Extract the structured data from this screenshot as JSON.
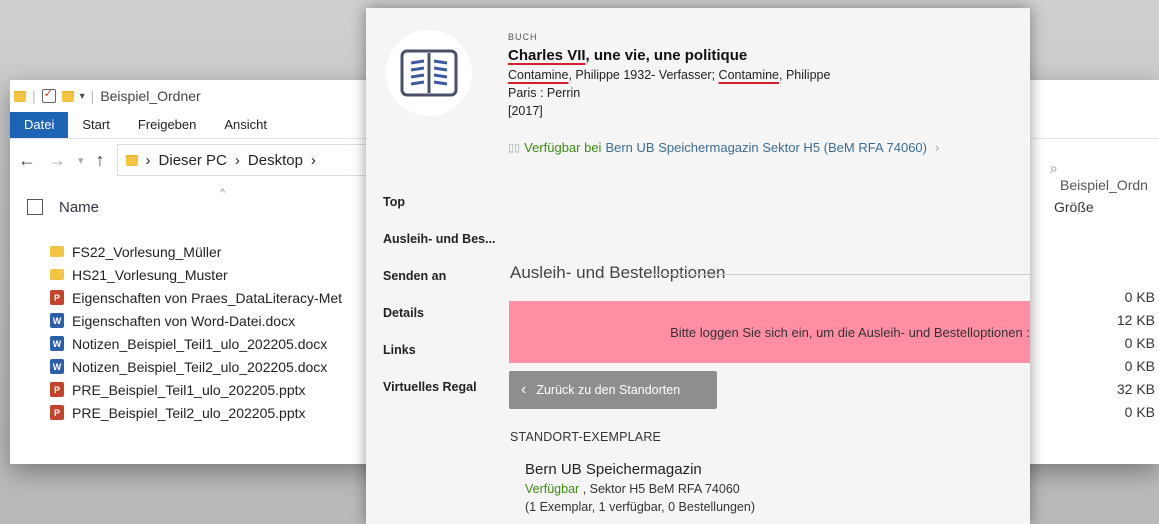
{
  "explorer": {
    "title": "Beispiel_Ordner",
    "ribbon_tabs": [
      "Datei",
      "Start",
      "Freigeben",
      "Ansicht"
    ],
    "breadcrumb": [
      "Dieser PC",
      "Desktop"
    ],
    "search_text": "Beispiel_Ordn",
    "columns": {
      "name": "Name",
      "size": "Größe"
    },
    "files": [
      {
        "name": "FS22_Vorlesung_Müller",
        "icon": "folder-icon",
        "size": ""
      },
      {
        "name": "HS21_Vorlesung_Muster",
        "icon": "folder-icon",
        "size": ""
      },
      {
        "name": "Eigenschaften von Praes_DataLiteracy-Met",
        "icon": "powerpoint-icon",
        "size": "0 KB"
      },
      {
        "name": "Eigenschaften von Word-Datei.docx",
        "icon": "word-icon",
        "size": "12 KB"
      },
      {
        "name": "Notizen_Beispiel_Teil1_ulo_202205.docx",
        "icon": "word-icon",
        "size": "0 KB"
      },
      {
        "name": "Notizen_Beispiel_Teil2_ulo_202205.docx",
        "icon": "word-icon",
        "size": "0 KB"
      },
      {
        "name": "PRE_Beispiel_Teil1_ulo_202205.pptx",
        "icon": "powerpoint-icon",
        "size": "32 KB"
      },
      {
        "name": "PRE_Beispiel_Teil2_ulo_202205.pptx",
        "icon": "powerpoint-icon",
        "size": "0 KB"
      }
    ]
  },
  "record": {
    "type": "BUCH",
    "title_part1": "Charles VII",
    "title_part2": ", une vie, une politique",
    "author1": "Contamine",
    "author_mid": ", Philippe 1932- Verfasser; ",
    "author2": "Contamine",
    "author_end": ", Philippe",
    "place": "Paris : Perrin",
    "year": "[2017]",
    "availability_status": "Verfügbar bei",
    "availability_location": "Bern UB Speichermagazin  Sektor H5 (BeM RFA 74060)"
  },
  "nav": [
    "Top",
    "Ausleih- und Bes...",
    "Senden an",
    "Details",
    "Links",
    "Virtuelles Regal"
  ],
  "loan": {
    "section_title": "Ausleih- und Bestelloptionen",
    "alert_text": "Bitte loggen Sie sich ein, um die Ausleih- und Bestelloptionen :",
    "back_button": "Zurück zu den Standorten",
    "holdings_heading": "STANDORT-EXEMPLARE",
    "library": "Bern UB Speichermagazin",
    "status": "Verfügbar",
    "shelf": " , Sektor H5 BeM RFA 74060",
    "counts": "(1 Exemplar, 1 verfügbar, 0 Bestellungen)"
  },
  "colors": {
    "ribbon_active": "#1d64b5",
    "alert_bg": "#ff8da3",
    "available_green": "#3b8d12",
    "link_blue": "#3d6d92",
    "underline_red": "#d41f2c"
  }
}
